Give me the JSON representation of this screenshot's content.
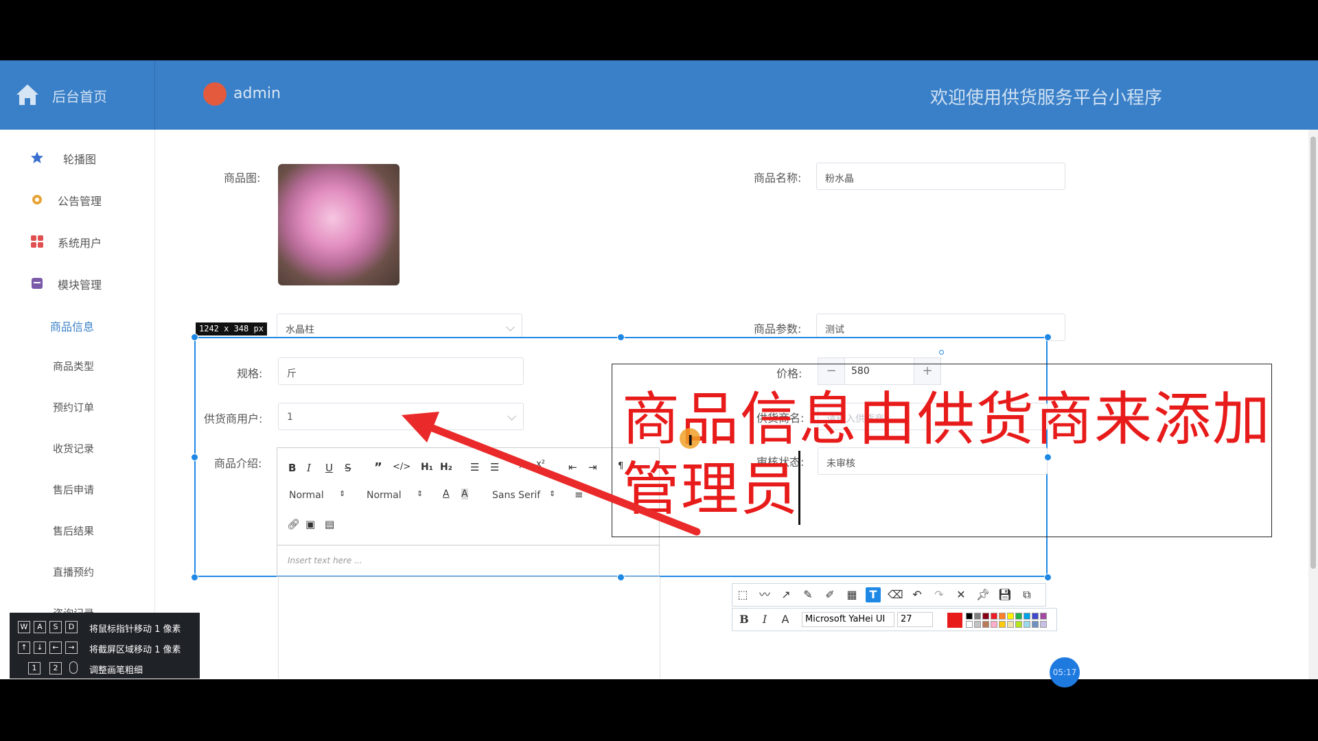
{
  "header": {
    "home_label": "后台首页",
    "admin_name": "admin",
    "welcome": "欢迎使用供货服务平台小程序"
  },
  "sidebar": {
    "items": [
      {
        "label": "轮播图",
        "icon": "star-icon"
      },
      {
        "label": "公告管理",
        "icon": "gear-icon"
      },
      {
        "label": "系统用户",
        "icon": "grid-icon"
      },
      {
        "label": "模块管理",
        "icon": "box-icon"
      },
      {
        "label": "商品信息",
        "icon": ""
      },
      {
        "label": "商品类型",
        "icon": ""
      },
      {
        "label": "预约订单",
        "icon": ""
      },
      {
        "label": "收货记录",
        "icon": ""
      },
      {
        "label": "售后申请",
        "icon": ""
      },
      {
        "label": "售后结果",
        "icon": ""
      },
      {
        "label": "直播预约",
        "icon": ""
      },
      {
        "label": "咨询记录",
        "icon": ""
      }
    ],
    "active_color": "#3a80c8"
  },
  "form": {
    "product_image_label": "商品图:",
    "product_name_label": "商品名称:",
    "product_name_value": "粉水晶",
    "category_value": "水晶柱",
    "params_label": "商品参数:",
    "params_value": "测试",
    "spec_label": "规格:",
    "spec_value": "斤",
    "price_label": "价格:",
    "price_value": "580",
    "supplier_user_label": "供货商用户:",
    "supplier_user_value": "1",
    "supplier_label": "供货商名:",
    "supplier_placeholder": "请输入供货商",
    "intro_label": "商品介绍:",
    "review_label": "审核状态:",
    "review_value": "未审核"
  },
  "editor": {
    "heading_select": "Normal",
    "size_select": "Normal",
    "font_select": "Sans Serif",
    "placeholder": "Insert text here ..."
  },
  "capture": {
    "size_tag": "1242 x 348",
    "size_unit": "px",
    "annotation_line1": "商品信息由供货商来添加",
    "annotation_line2": "管理员",
    "font_name": "Microsoft YaHei UI",
    "font_size": "27",
    "text_color": "#e81b1b"
  },
  "hints": {
    "keys_row1": [
      "W",
      "A",
      "S",
      "D"
    ],
    "row1_text": "将鼠标指针移动 1 像素",
    "keys_row2": [
      "↑",
      "↓",
      "←",
      "→"
    ],
    "row2_text": "将截屏区域移动 1 像素",
    "keys_row3": [
      "1",
      "2"
    ],
    "row3_text": "调整画笔粗细"
  },
  "timer": "05:17"
}
